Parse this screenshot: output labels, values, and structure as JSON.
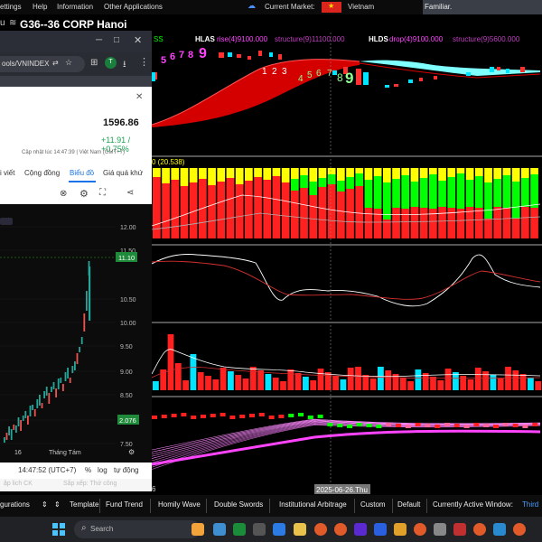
{
  "menubar": {
    "items": [
      "ettings",
      "Help",
      "Information",
      "Other Applications"
    ],
    "current_market_label": "Current Market:",
    "market_name": "Vietnam",
    "familiar": "Familiar."
  },
  "main": {
    "title": "G36--36 CORP  Hanoi"
  },
  "indicators": {
    "ss_label": "SS",
    "hlas": "HLAS",
    "hlas_rise": "rise(4)9100.000",
    "hlas_structure": "structure(9)11100.000",
    "hlds": "HLDS",
    "hlds_drop": "drop(4)9100.000",
    "hlds_structure": "structure(9)5600.000",
    "count_top": [
      "5",
      "6",
      "7",
      "8",
      "9"
    ],
    "count_mid": [
      "1",
      "2",
      "3"
    ],
    "count_low": [
      "4",
      "5",
      "6",
      "7",
      "8",
      "9"
    ],
    "panel2_label": "0 (20.538)",
    "date_label": "2025-06-26.Thu",
    "left_tick": "6"
  },
  "browser": {
    "url": "ools/VNINDEX",
    "price": "1596.86",
    "change": "+11.91 / +0.75%",
    "updated": "Cập nhật lúc  14:47:39 | Việt Nam (GMT+7)",
    "tabs": [
      "i viết",
      "Cộng đồng",
      "Biểu đồ",
      "Giá quá khứ"
    ],
    "y_ticks": [
      "12.00",
      "11.50",
      "11.10",
      "10.50",
      "10.00",
      "9.50",
      "9.00",
      "8.50",
      "8.00",
      "7.50"
    ],
    "last_value": "11.10",
    "badge": "2.076",
    "x_labels": [
      "16",
      "Tháng Tám"
    ],
    "clock": "14:47:52 (UTC+7)",
    "pct": "%",
    "log": "log",
    "auto": "tự động",
    "below_chart": [
      "ập lich CK",
      "Sắp xếp: Thứ công"
    ]
  },
  "bottombar": {
    "items": [
      "gurations",
      "Template",
      "Fund Trend",
      "Homily Wave",
      "Double Swords",
      "Institutional Arbitrage",
      "Custom",
      "Default",
      "Currently Active Window:",
      "Third"
    ]
  },
  "taskbar": {
    "search": "Search"
  },
  "colors": {
    "up": "#ff2020",
    "down": "#00e5ff",
    "green": "#00ff00",
    "yellow": "#ffff00",
    "magenta": "#ff44ff",
    "cyan_band": "#80ffff"
  }
}
